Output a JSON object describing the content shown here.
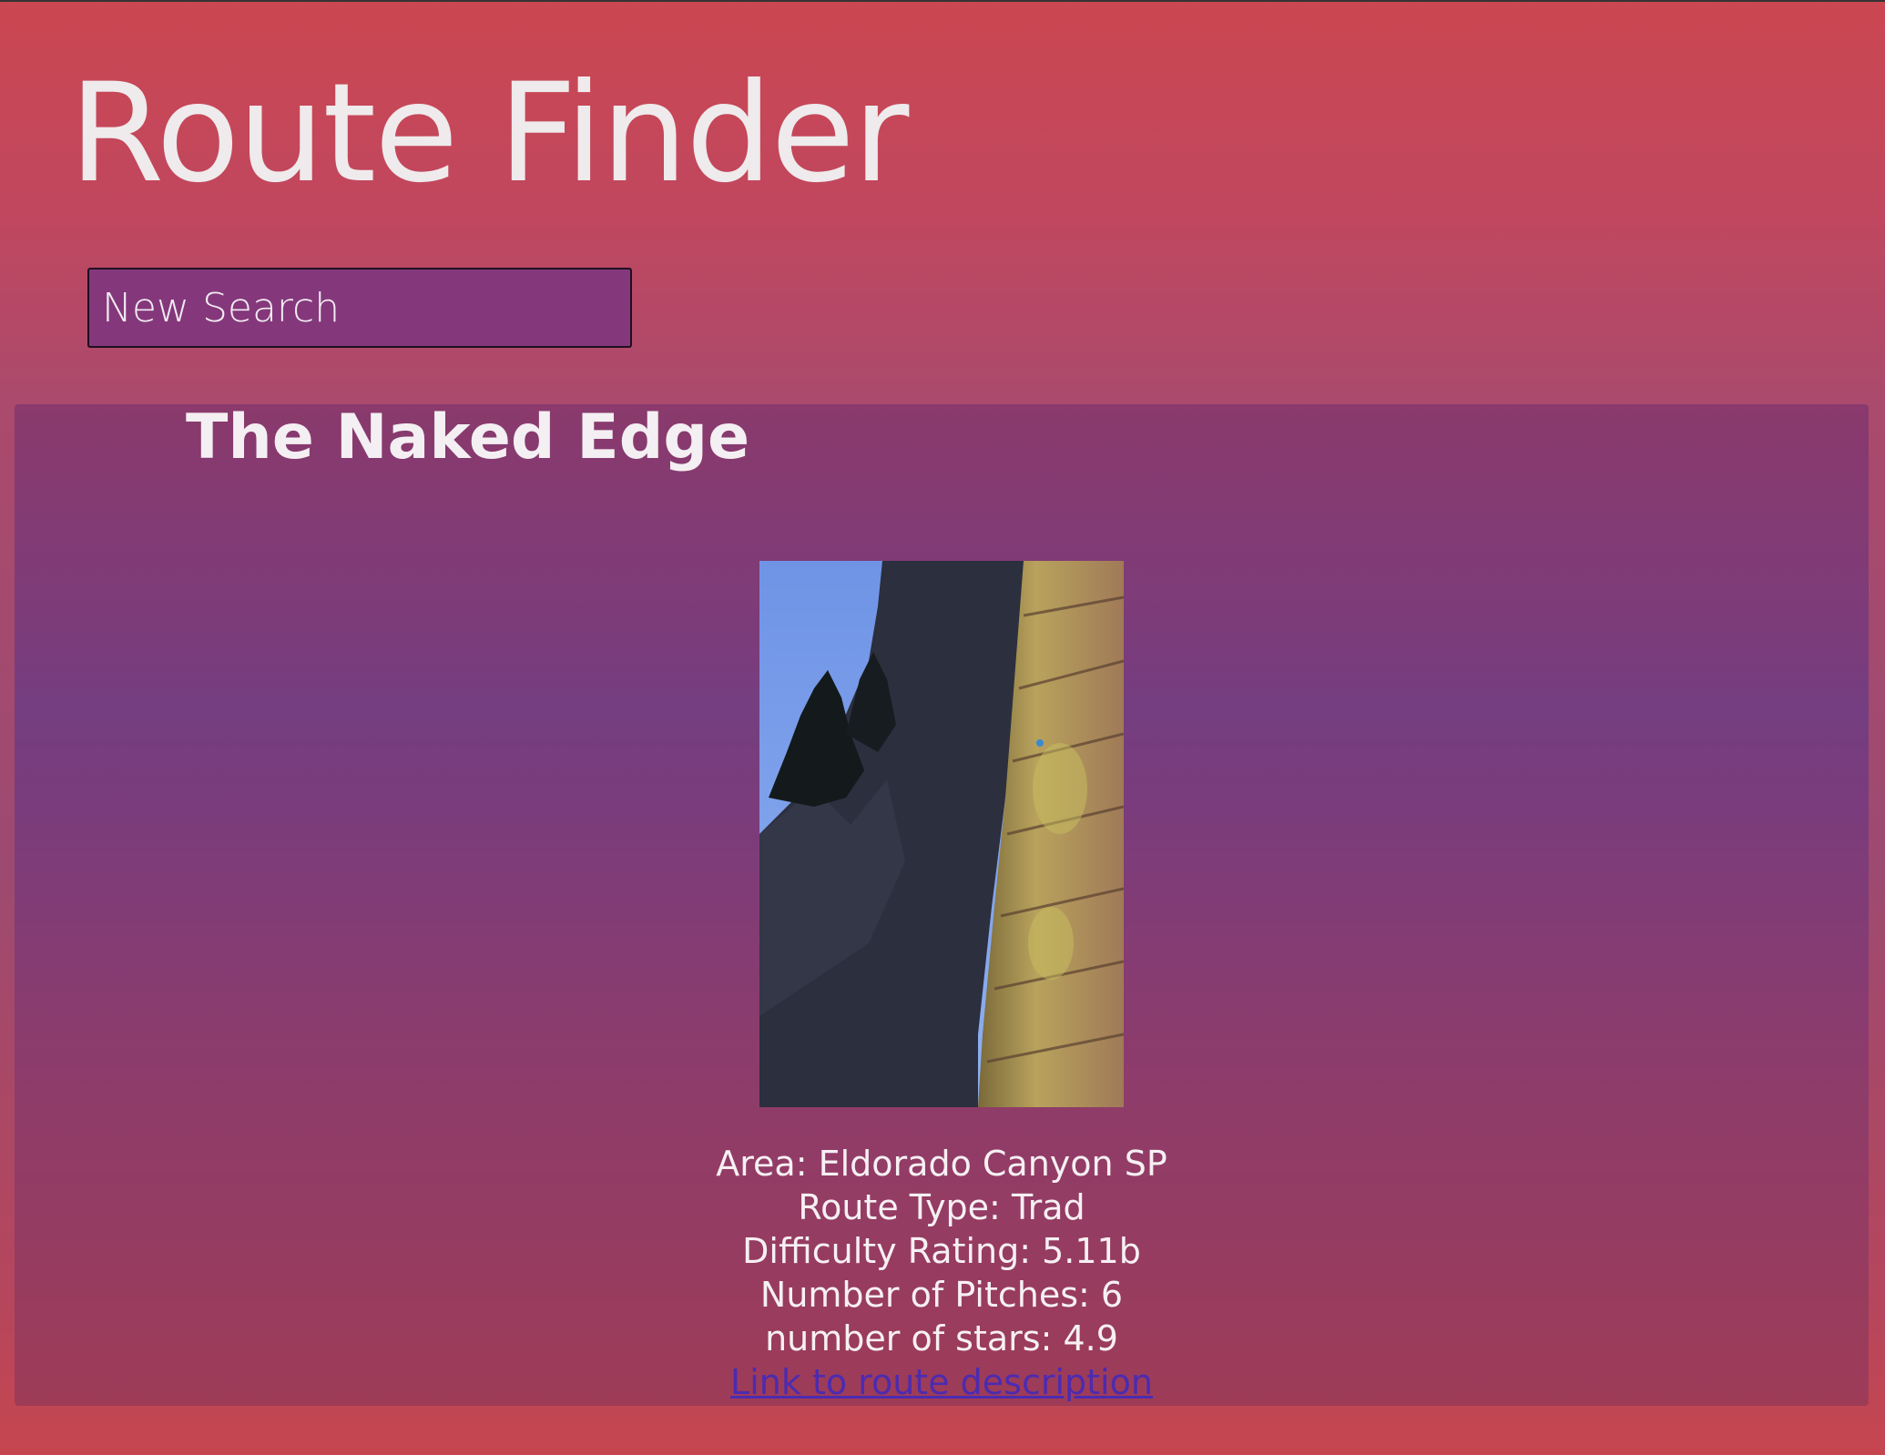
{
  "header": {
    "title": "Route Finder"
  },
  "search": {
    "placeholder": "New Search"
  },
  "route": {
    "name": "The Naked Edge",
    "area": "Area: Eldorado Canyon SP",
    "type": "Route Type: Trad",
    "difficulty": "Difficulty Rating: 5.11b",
    "pitches": "Number of Pitches: 6",
    "stars": "number of stars: 4.9",
    "link_label": "Link to route description",
    "image_alt": "The Naked Edge"
  },
  "colors": {
    "page_top": "#cb4751",
    "card": "#7a3c7c",
    "search_bg": "#84387b",
    "link": "#4c2bb0",
    "text": "#f4eff2"
  }
}
